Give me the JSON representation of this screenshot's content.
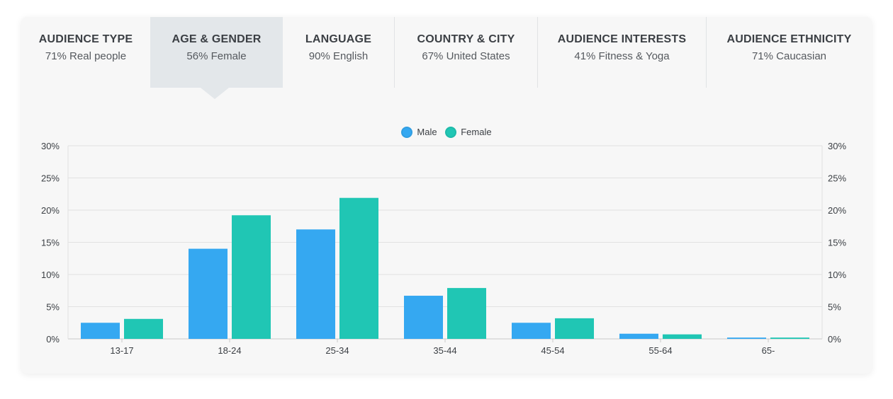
{
  "tabs": [
    {
      "title": "AUDIENCE TYPE",
      "value": "71% Real people"
    },
    {
      "title": "AGE & GENDER",
      "value": "56% Female",
      "active": true
    },
    {
      "title": "LANGUAGE",
      "value": "90% English"
    },
    {
      "title": "COUNTRY & CITY",
      "value": "67% United States"
    },
    {
      "title": "AUDIENCE INTERESTS",
      "value": "41% Fitness & Yoga"
    },
    {
      "title": "AUDIENCE ETHNICITY",
      "value": "71% Caucasian"
    }
  ],
  "colors": {
    "male": "#35a8f1",
    "female": "#20c6b4",
    "grid": "#e2e2e2",
    "axis": "#c9c9c9"
  },
  "chart_data": {
    "type": "bar",
    "categories": [
      "13-17",
      "18-24",
      "25-34",
      "35-44",
      "45-54",
      "55-64",
      "65-"
    ],
    "series": [
      {
        "name": "Male",
        "values": [
          2.5,
          14.0,
          17.0,
          6.7,
          2.5,
          0.8,
          0.2
        ]
      },
      {
        "name": "Female",
        "values": [
          3.1,
          19.2,
          21.9,
          7.9,
          3.2,
          0.7,
          0.2
        ]
      }
    ],
    "ylim": [
      0,
      30
    ],
    "yticks": [
      "0%",
      "5%",
      "10%",
      "15%",
      "20%",
      "25%",
      "30%"
    ],
    "yticks_right": [
      "0%",
      "5%",
      "10%",
      "15%",
      "20%",
      "25%",
      "30%"
    ],
    "grid": true,
    "legend_position": "top-center"
  }
}
